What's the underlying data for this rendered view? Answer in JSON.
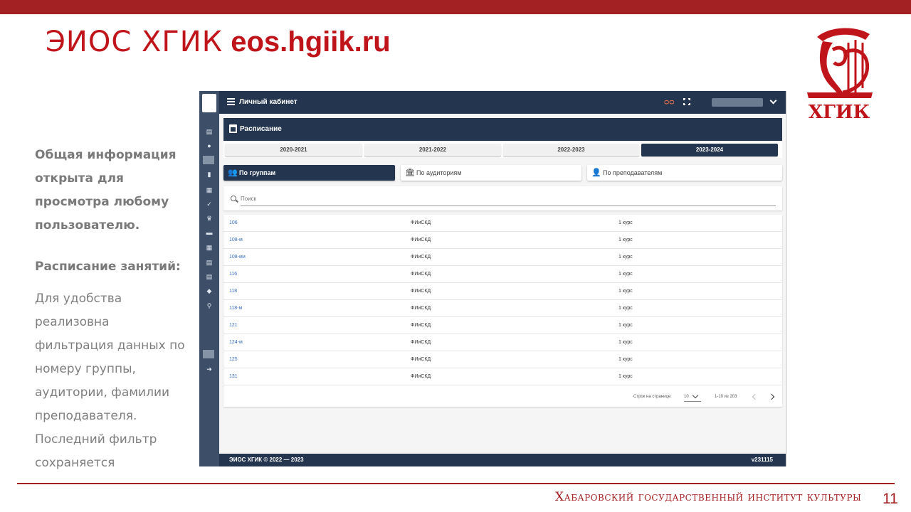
{
  "slide": {
    "title_thin": "ЭИОС ХГИК",
    "title_bold": "eos.hgiik.ru",
    "logo_text": "ХГИК",
    "paragraph1": "Общая информация открыта для просмотра любому пользователю.",
    "paragraph2": "Расписание занятий:",
    "paragraph3": "Для удобства реализовна фильтрация данных по номеру группы, аудитории, фамилии преподавателя. Последний фильтр сохраняется",
    "footer_institute": "Хабаровский государственный институт культуры",
    "page_number": "11"
  },
  "app": {
    "header_title": "Личный кабинет",
    "schedule_title": "Расписание",
    "years": [
      {
        "label": "2020-2021"
      },
      {
        "label": "2021-2022"
      },
      {
        "label": "2022-2023"
      },
      {
        "label": "2023-2024"
      }
    ],
    "filters": [
      {
        "label": "По группам"
      },
      {
        "label": "По аудиториям"
      },
      {
        "label": "По преподавателям"
      }
    ],
    "search_placeholder": "Поиск",
    "rows": [
      {
        "group": "106",
        "faculty": "ФИиСКД",
        "course": "1 курс"
      },
      {
        "group": "108-м",
        "faculty": "ФИиСКД",
        "course": "1 курс"
      },
      {
        "group": "108-ми",
        "faculty": "ФИиСКД",
        "course": "1 курс"
      },
      {
        "group": "116",
        "faculty": "ФИиСКД",
        "course": "1 курс"
      },
      {
        "group": "118",
        "faculty": "ФИиСКД",
        "course": "1 курс"
      },
      {
        "group": "118-м",
        "faculty": "ФИиСКД",
        "course": "1 курс"
      },
      {
        "group": "121",
        "faculty": "ФИиСКД",
        "course": "1 курс"
      },
      {
        "group": "124-м",
        "faculty": "ФИиСКД",
        "course": "1 курс"
      },
      {
        "group": "125",
        "faculty": "ФИиСКД",
        "course": "1 курс"
      },
      {
        "group": "131",
        "faculty": "ФИиСКД",
        "course": "1 курс"
      }
    ],
    "pager": {
      "rows_label": "Строк на странице:",
      "rows_value": "10",
      "range": "1-10 из 203"
    },
    "footer_left": "ЭИОС ХГИК © 2022 — 2023",
    "footer_right": "v231115"
  }
}
